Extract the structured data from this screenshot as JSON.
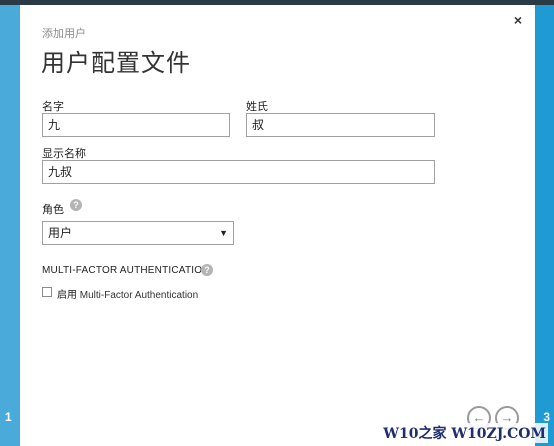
{
  "dialog": {
    "subtitle": "添加用户",
    "title": "用户配置文件",
    "close": "×"
  },
  "form": {
    "first_name_label": "名字",
    "first_name_value": "九",
    "last_name_label": "姓氏",
    "last_name_value": "叔",
    "display_name_label": "显示名称",
    "display_name_value": "九叔",
    "role_label": "角色",
    "role_value": "用户",
    "role_arrow": "▼",
    "help_glyph": "?"
  },
  "mfa": {
    "heading": "MULTI-FACTOR AUTHENTICATION",
    "checkbox_label_cn": "启用",
    "checkbox_label_en": "Multi-Factor Authentication",
    "checked": false
  },
  "steps": {
    "current": "1",
    "next": "3"
  },
  "nav": {
    "prev": "←",
    "next": "→"
  },
  "watermark": "W10之家 W10ZJ.COM",
  "colors": {
    "accent_blue": "#3fa6d8",
    "dialog_bg": "#ffffff"
  }
}
